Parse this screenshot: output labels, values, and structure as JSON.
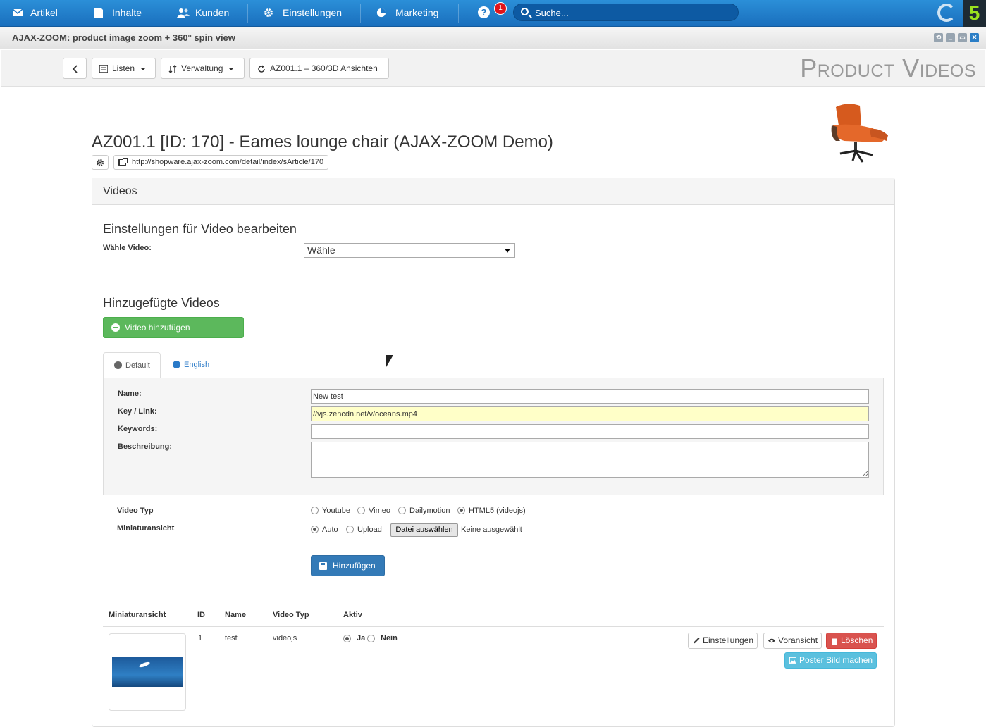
{
  "nav": {
    "items": [
      {
        "label": "Artikel",
        "icon": "envelope-icon"
      },
      {
        "label": "Inhalte",
        "icon": "document-icon"
      },
      {
        "label": "Kunden",
        "icon": "users-icon"
      },
      {
        "label": "Einstellungen",
        "icon": "gear-icon"
      },
      {
        "label": "Marketing",
        "icon": "pie-chart-icon"
      }
    ],
    "help": "?",
    "notification_count": "1",
    "search_placeholder": "Suche...",
    "brand_color": "#1f7fcf"
  },
  "window": {
    "title": "AJAX-ZOOM: product image zoom + 360° spin view"
  },
  "toolbar": {
    "back_icon": "chevron-left-icon",
    "listen_label": "Listen",
    "verwaltung_label": "Verwaltung",
    "article_label": "AZ001.1 – 360/3D Ansichten",
    "page_title": "Product Videos"
  },
  "product": {
    "title": "AZ001.1 [ID: 170] - Eames lounge chair (AJAX-ZOOM Demo)",
    "url": "http://shopware.ajax-zoom.com/detail/index/sArticle/170"
  },
  "panel": {
    "heading": "Videos",
    "settings_heading": "Einstellungen für Video bearbeiten",
    "choose_label": "Wähle Video:",
    "choose_value": "Wähle",
    "added_heading": "Hinzugefügte Videos",
    "add_video_button": "Video hinzufügen"
  },
  "tabs": [
    {
      "label": "Default"
    },
    {
      "label": "English"
    }
  ],
  "form": {
    "name_label": "Name:",
    "name_value": "New test",
    "key_label": "Key / Link:",
    "key_value": "//vjs.zencdn.net/v/oceans.mp4",
    "keywords_label": "Keywords:",
    "keywords_value": "",
    "desc_label": "Beschreibung:",
    "video_type_label": "Video Typ",
    "video_types": [
      "Youtube",
      "Vimeo",
      "Dailymotion",
      "HTML5 (videojs)"
    ],
    "video_type_selected": "HTML5 (videojs)",
    "thumb_label": "Miniaturansicht",
    "thumb_options": [
      "Auto",
      "Upload"
    ],
    "thumb_selected": "Auto",
    "file_button": "Datei auswählen",
    "file_status": "Keine ausgewählt",
    "submit_button": "Hinzufügen"
  },
  "table": {
    "headers": [
      "Miniaturansicht",
      "ID",
      "Name",
      "Video Typ",
      "Aktiv"
    ],
    "rows": [
      {
        "id": "1",
        "name": "test",
        "type": "videojs",
        "aktiv_yes": "Ja",
        "aktiv_no": "Nein",
        "aktiv": "Ja"
      }
    ],
    "actions": {
      "settings": "Einstellungen",
      "preview": "Voransicht",
      "delete": "Löschen",
      "poster": "Poster Bild machen"
    }
  }
}
